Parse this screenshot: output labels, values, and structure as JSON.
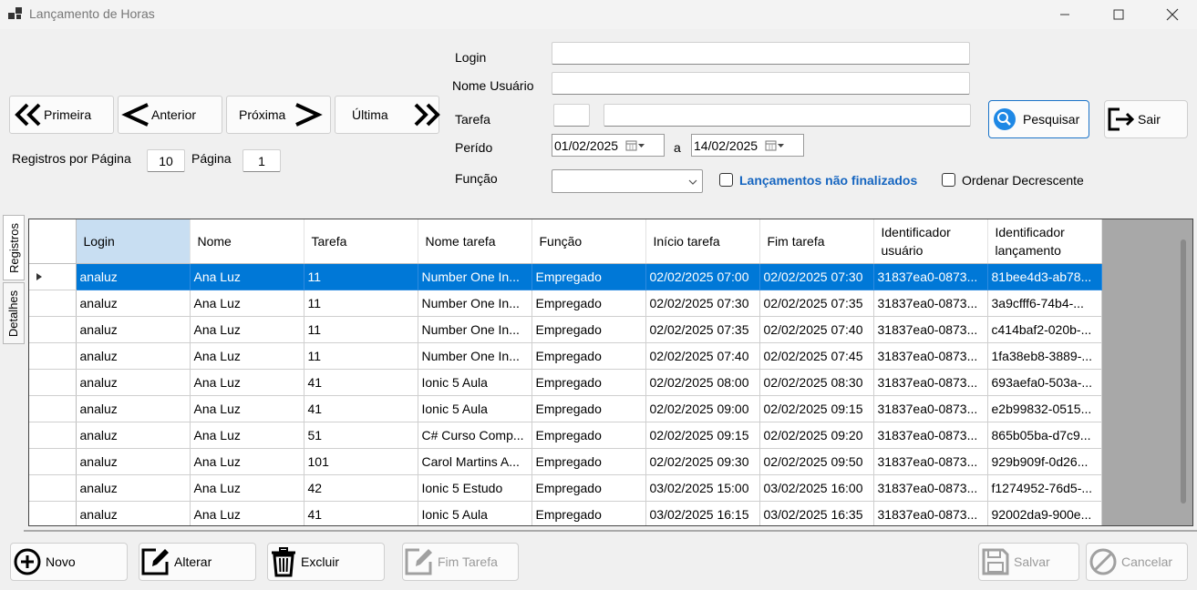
{
  "window": {
    "title": "Lançamento de Horas"
  },
  "nav": {
    "first": "Primeira",
    "prev": "Anterior",
    "next": "Próxima",
    "last": "Última"
  },
  "paging": {
    "per_page_label": "Registros por Página",
    "per_page_value": "10",
    "page_label": "Página",
    "page_value": "1"
  },
  "filters": {
    "login_label": "Login",
    "login_value": "",
    "user_label": "Nome Usuário",
    "user_value": "",
    "task_label": "Tarefa",
    "task_id_value": "",
    "task_name_value": "",
    "period_label": "Perído",
    "date_from": "01/02/2025",
    "date_sep": "a",
    "date_to": "14/02/2025",
    "function_label": "Função",
    "function_value": "",
    "unfinished_label": "Lançamentos não finalizados",
    "unfinished_checked": false,
    "desc_label": "Ordenar Decrescente",
    "desc_checked": false
  },
  "buttons": {
    "search": "Pesquisar",
    "exit": "Sair",
    "new": "Novo",
    "edit": "Alterar",
    "delete": "Excluir",
    "finish": "Fim Tarefa",
    "save": "Salvar",
    "cancel": "Cancelar"
  },
  "side_tabs": {
    "records": "Registros",
    "details": "Detalhes"
  },
  "grid": {
    "columns": [
      "Login",
      "Nome",
      "Tarefa",
      "Nome tarefa",
      "Função",
      "Início tarefa",
      "Fim tarefa",
      "Identificador usuário",
      "Identificador lançamento"
    ],
    "rows": [
      [
        "analuz",
        "Ana Luz",
        "11",
        "Number One In...",
        "Empregado",
        "02/02/2025 07:00",
        "02/02/2025 07:30",
        "31837ea0-0873...",
        "81bee4d3-ab78..."
      ],
      [
        "analuz",
        "Ana Luz",
        "11",
        "Number One In...",
        "Empregado",
        "02/02/2025 07:30",
        "02/02/2025 07:35",
        "31837ea0-0873...",
        "3a9cfff6-74b4-..."
      ],
      [
        "analuz",
        "Ana Luz",
        "11",
        "Number One In...",
        "Empregado",
        "02/02/2025 07:35",
        "02/02/2025 07:40",
        "31837ea0-0873...",
        "c414baf2-020b-..."
      ],
      [
        "analuz",
        "Ana Luz",
        "11",
        "Number One In...",
        "Empregado",
        "02/02/2025 07:40",
        "02/02/2025 07:45",
        "31837ea0-0873...",
        "1fa38eb8-3889-..."
      ],
      [
        "analuz",
        "Ana Luz",
        "41",
        "Ionic 5 Aula",
        "Empregado",
        "02/02/2025 08:00",
        "02/02/2025 08:30",
        "31837ea0-0873...",
        "693aefa0-503a-..."
      ],
      [
        "analuz",
        "Ana Luz",
        "41",
        "Ionic 5 Aula",
        "Empregado",
        "02/02/2025 09:00",
        "02/02/2025 09:15",
        "31837ea0-0873...",
        "e2b99832-0515..."
      ],
      [
        "analuz",
        "Ana Luz",
        "51",
        "C# Curso Comp...",
        "Empregado",
        "02/02/2025 09:15",
        "02/02/2025 09:20",
        "31837ea0-0873...",
        "865b05ba-d7c9..."
      ],
      [
        "analuz",
        "Ana Luz",
        "101",
        "Carol Martins A...",
        "Empregado",
        "02/02/2025 09:30",
        "02/02/2025 09:50",
        "31837ea0-0873...",
        "929b909f-0d26..."
      ],
      [
        "analuz",
        "Ana Luz",
        "42",
        "Ionic 5 Estudo",
        "Empregado",
        "03/02/2025 15:00",
        "03/02/2025 16:00",
        "31837ea0-0873...",
        "f1274952-76d5-..."
      ],
      [
        "analuz",
        "Ana Luz",
        "41",
        "Ionic 5 Aula",
        "Empregado",
        "03/02/2025 16:15",
        "03/02/2025 16:35",
        "31837ea0-0873...",
        "92002da9-900e..."
      ]
    ],
    "selected_row": 0
  }
}
